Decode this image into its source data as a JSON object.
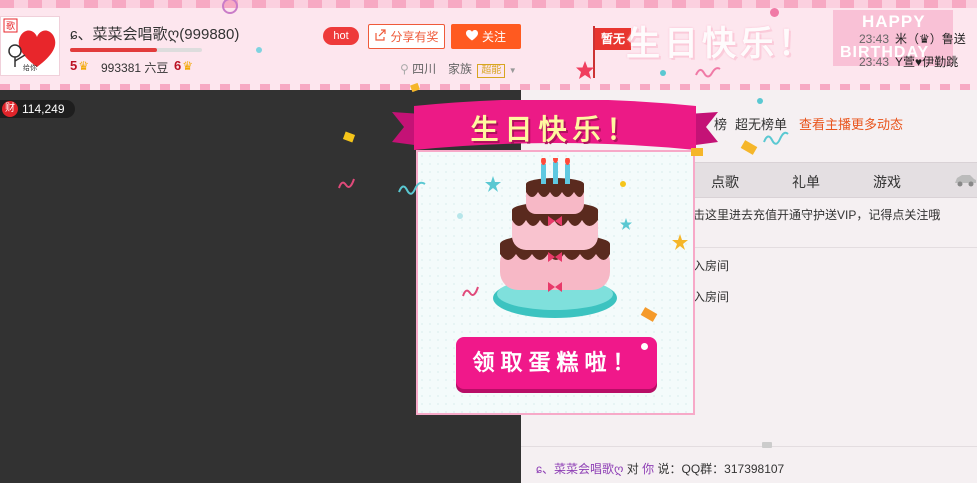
{
  "header": {
    "avatar_caption": "给你",
    "avatar_badge": "歌",
    "anchor_name": "ɕ、菜菜会唱歌ღ(999880)",
    "level_left": "5",
    "beans": "993381 六豆",
    "level_right": "6",
    "hot_label": "hot",
    "share_label": "分享有奖",
    "follow_label": "关注",
    "location": "四川",
    "family_label": "家族",
    "family_tag": "超能",
    "flag_label": "暂无",
    "decor_text": "生日快乐！",
    "happy_text": "HAPPY",
    "birthday_text": "BIRTHDAY",
    "messages": [
      {
        "time": "23:43",
        "text": "米（♛）鲁送"
      },
      {
        "time": "23:43",
        "text": "Y萱♥伊勤跳"
      }
    ]
  },
  "video": {
    "wealth_icon": "财",
    "wealth_value": "114,249"
  },
  "panel": {
    "rank_partial": "榜",
    "rank_other": "超无榜单",
    "more_link": "查看主播更多动态",
    "tabs": [
      "点歌",
      "礼单",
      "游戏"
    ],
    "chat_lines": [
      "击这里进去充值开通守护送VIP，记得点关注哦",
      "入房间",
      "入房间"
    ],
    "bottom_line": {
      "name": "ɕ、菜菜会唱歌ღ",
      "to": "对",
      "you": "你",
      "said": "说：QQ群：317398107"
    }
  },
  "popup": {
    "title": "生日快乐！",
    "claim_button": "领取蛋糕啦！"
  },
  "colors": {
    "accent": "#f0188a",
    "follow": "#ff5a20",
    "more_link": "#e9541c",
    "video_bg": "#323232"
  }
}
